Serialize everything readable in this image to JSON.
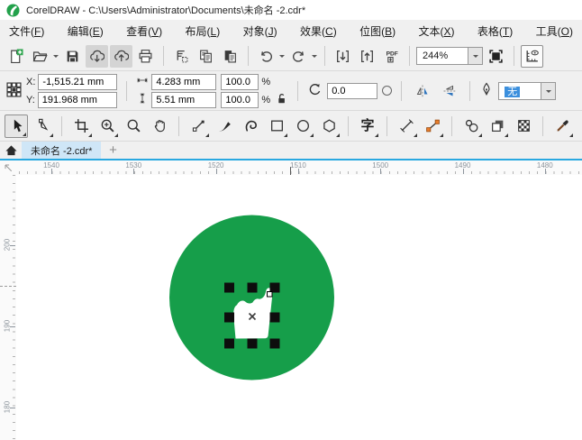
{
  "titlebar": {
    "title": "CorelDRAW - C:\\Users\\Administrator\\Documents\\未命名 -2.cdr*",
    "logo_icon": "coreldraw-balloon-logo",
    "logo_color": "#22a14b"
  },
  "menubar": {
    "items": [
      {
        "id": "file",
        "text": "文件",
        "key": "F"
      },
      {
        "id": "edit",
        "text": "编辑",
        "key": "E"
      },
      {
        "id": "view",
        "text": "查看",
        "key": "V"
      },
      {
        "id": "layout",
        "text": "布局",
        "key": "L"
      },
      {
        "id": "object",
        "text": "对象",
        "key": "J"
      },
      {
        "id": "effects",
        "text": "效果",
        "key": "C"
      },
      {
        "id": "bitmaps",
        "text": "位图",
        "key": "B"
      },
      {
        "id": "text",
        "text": "文本",
        "key": "X"
      },
      {
        "id": "table",
        "text": "表格",
        "key": "T"
      },
      {
        "id": "tools",
        "text": "工具",
        "key": "O"
      }
    ]
  },
  "toolbar": {
    "zoom_level": "244%",
    "items": [
      {
        "name": "new-document-button",
        "icon": "new-doc"
      },
      {
        "name": "open-button",
        "icon": "open",
        "caret": true
      },
      {
        "name": "save-button",
        "icon": "save"
      },
      {
        "name": "cloud-download-button",
        "icon": "cloud-down",
        "toggled": true
      },
      {
        "name": "cloud-upload-button",
        "icon": "cloud-up",
        "toggled": true
      },
      {
        "name": "print-button",
        "icon": "print"
      },
      {
        "sep": true
      },
      {
        "name": "cut-button",
        "icon": "cut"
      },
      {
        "name": "copy-button",
        "icon": "copy"
      },
      {
        "name": "paste-button",
        "icon": "paste"
      },
      {
        "sep": true
      },
      {
        "name": "undo-button",
        "icon": "undo",
        "caret": true
      },
      {
        "name": "redo-button",
        "icon": "redo",
        "caret": true
      },
      {
        "sep": true
      },
      {
        "name": "import-button",
        "icon": "import"
      },
      {
        "name": "export-button",
        "icon": "export"
      },
      {
        "name": "pdf-button",
        "icon": "pdf"
      },
      {
        "sep": true
      },
      {
        "combo": "zoom"
      },
      {
        "name": "fullscreen-preview-button",
        "icon": "fullscreen"
      },
      {
        "sep": true
      },
      {
        "name": "ruler-toggle-button",
        "icon": "ruler-eye",
        "bordered": true
      }
    ]
  },
  "property_bar": {
    "x_label": "X:",
    "x_value": "-1,515.21 mm",
    "y_label": "Y:",
    "y_value": "191.968 mm",
    "width_value": "4.283 mm",
    "height_value": "5.51 mm",
    "scale_h_value": "100.0",
    "scale_v_value": "100.0",
    "percent_label": "%",
    "rotation_value": "0.0",
    "outline_width_value": "无",
    "outline_selection_color": "#3b8fdd"
  },
  "toolbox": {
    "text_glyph": "字",
    "tools": [
      {
        "name": "pick-tool",
        "icon": "pick",
        "selected": true,
        "flyout": true
      },
      {
        "name": "shape-tool",
        "icon": "shape",
        "flyout": true
      },
      {
        "sep": true
      },
      {
        "name": "crop-tool",
        "icon": "crop",
        "flyout": true
      },
      {
        "name": "zoom-tool",
        "icon": "zoom",
        "flyout": true
      },
      {
        "name": "magnify-tool",
        "icon": "magnify"
      },
      {
        "name": "pan-tool",
        "icon": "pan"
      },
      {
        "sep": true
      },
      {
        "name": "freehand-tool",
        "icon": "freehand",
        "flyout": true
      },
      {
        "name": "artistic-media-tool",
        "icon": "brush"
      },
      {
        "name": "bspline-tool",
        "icon": "bspline"
      },
      {
        "name": "rectangle-tool",
        "icon": "rect",
        "flyout": true
      },
      {
        "name": "ellipse-tool",
        "icon": "ellipse",
        "flyout": true
      },
      {
        "name": "polygon-tool",
        "icon": "polygon",
        "flyout": true
      },
      {
        "sep": true
      },
      {
        "name": "text-tool",
        "icon": "text",
        "flyout": true
      },
      {
        "sep": true
      },
      {
        "name": "dimension-tool",
        "icon": "dimension",
        "flyout": true
      },
      {
        "name": "connector-tool",
        "icon": "connector",
        "flyout": true
      },
      {
        "sep": true
      },
      {
        "name": "blend-tool",
        "icon": "blend",
        "flyout": true
      },
      {
        "name": "drop-shadow-tool",
        "icon": "dropshadow",
        "flyout": true
      },
      {
        "name": "transparency-tool",
        "icon": "checker"
      },
      {
        "sep": true
      },
      {
        "name": "eyedropper-tool",
        "icon": "eyedropper",
        "flyout": true
      },
      {
        "name": "interactive-fill-tool",
        "icon": "ifill",
        "flyout": true
      },
      {
        "name": "smart-fill-tool",
        "icon": "ifill2"
      }
    ]
  },
  "tabbar": {
    "active_tab": "未命名 -2.cdr*",
    "new_tab_label": "+",
    "home_icon": "home-icon"
  },
  "rulers": {
    "horizontal_labels": [
      "1540",
      "1530",
      "1520",
      "1510",
      "1500",
      "1490",
      "1480"
    ],
    "vertical_labels": [
      "200",
      "190",
      "180"
    ]
  },
  "canvas": {
    "circle_color": "#169e4a",
    "shape_color": "#ffffff",
    "selection": {
      "handle_color": "#0d0d0d",
      "center_marker": "x-cross",
      "node_marker": "white-square-node"
    }
  }
}
